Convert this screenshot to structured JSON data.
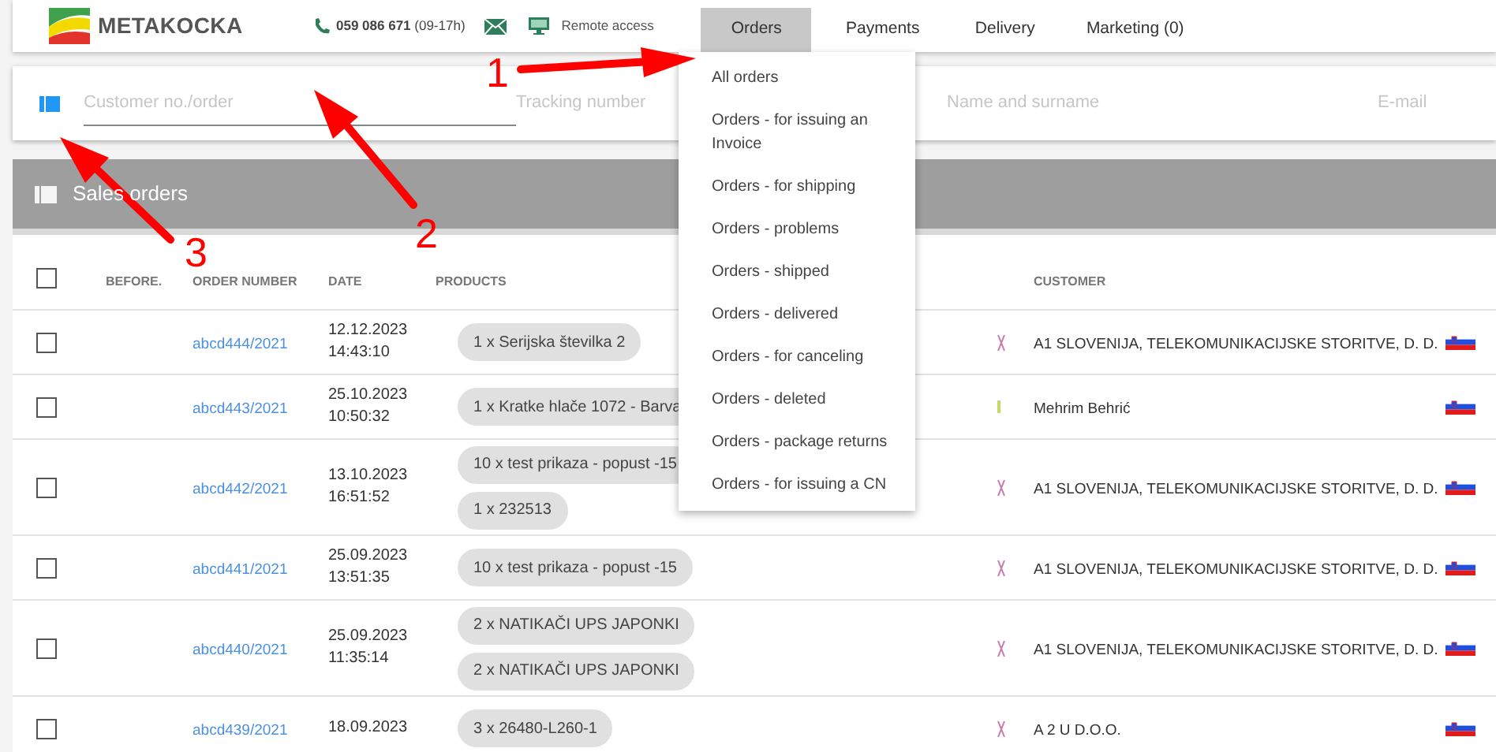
{
  "header": {
    "logo": "METAKOCKA",
    "phone": "**059 086 671** (09-17h)",
    "remote": "Remote access"
  },
  "nav": [
    {
      "label": "Orders",
      "selected": true
    },
    {
      "label": "Payments",
      "selected": false
    },
    {
      "label": "Delivery",
      "selected": false
    },
    {
      "label": "Marketing (0)",
      "selected": false
    }
  ],
  "orders_menu": {
    "items": [
      "All orders",
      "Orders - for issuing an Invoice",
      "Orders - for shipping",
      "Orders - problems",
      "Orders - shipped",
      "Orders - delivered",
      "Orders - for canceling",
      "Orders - deleted",
      "Orders - package returns",
      "Orders - for issuing a CN"
    ]
  },
  "search": {
    "fields": [
      {
        "placeholder": "Customer no./order"
      },
      {
        "placeholder": "Tracking number"
      },
      {
        "placeholder": "Name and surname"
      },
      {
        "placeholder": "E-mail"
      }
    ]
  },
  "panel": {
    "title": "Sales orders"
  },
  "table": {
    "select_all": {
      "checked": false
    },
    "columns": [
      "BEFORE.",
      "ORDER NUMBER",
      "DATE",
      "PRODUCTS",
      "CUSTOMER"
    ],
    "rows": [
      {
        "checked": false,
        "order": "abcd444/2021",
        "date": "12.12.2023",
        "time": "14:43:10",
        "products": [
          "1 x Serijska številka 2"
        ],
        "marker": {
          "kind": "cross",
          "color": "#c97bb0"
        },
        "customer": "A1 SLOVENIJA, TELEKOMUNIKACIJSKE STORITVE, D. D."
      },
      {
        "checked": false,
        "order": "abcd443/2021",
        "date": "25.10.2023",
        "time": "10:50:32",
        "products": [
          "1 x Kratke hlače 1072 - Barva"
        ],
        "marker": {
          "kind": "bar",
          "color": "#c4d96a"
        },
        "customer": "Mehrim Behrić"
      },
      {
        "checked": false,
        "order": "abcd442/2021",
        "date": "13.10.2023",
        "time": "16:51:52",
        "products": [
          "10 x test prikaza - popust -15",
          "1 x 232513"
        ],
        "marker": {
          "kind": "cross",
          "color": "#c97bb0"
        },
        "customer": "A1 SLOVENIJA, TELEKOMUNIKACIJSKE STORITVE, D. D."
      },
      {
        "checked": false,
        "order": "abcd441/2021",
        "date": "25.09.2023",
        "time": "13:51:35",
        "products": [
          "10 x test prikaza - popust -15"
        ],
        "marker": {
          "kind": "cross",
          "color": "#c97bb0"
        },
        "customer": "A1 SLOVENIJA, TELEKOMUNIKACIJSKE STORITVE, D. D."
      },
      {
        "checked": false,
        "order": "abcd440/2021",
        "date": "25.09.2023",
        "time": "11:35:14",
        "products": [
          "2 x NATIKAČI UPS JAPONKI",
          "2 x NATIKAČI UPS JAPONKI"
        ],
        "marker": {
          "kind": "cross",
          "color": "#c97bb0"
        },
        "customer": "A1 SLOVENIJA, TELEKOMUNIKACIJSKE STORITVE, D. D."
      },
      {
        "checked": false,
        "order": "abcd439/2021",
        "date": "18.09.2023",
        "products": [
          "3 x 26480-L260-1"
        ],
        "marker": {
          "kind": "cross",
          "color": "#c97bb0"
        },
        "customer": "A 2 U D.O.O."
      }
    ]
  },
  "annotations": [
    {
      "label": "1"
    },
    {
      "label": "2"
    },
    {
      "label": "3"
    }
  ]
}
